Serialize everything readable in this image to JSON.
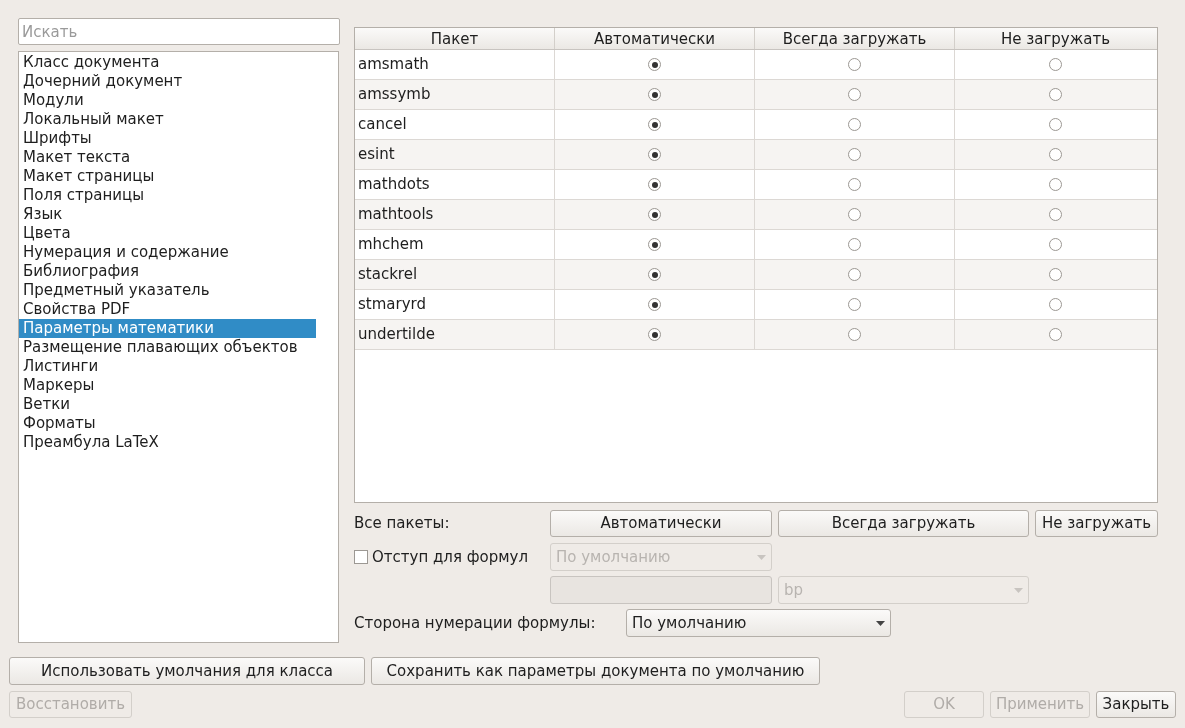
{
  "search": {
    "placeholder": "Искать"
  },
  "sidebar": {
    "items": [
      {
        "label": "Класс документа",
        "selected": false
      },
      {
        "label": "Дочерний документ",
        "selected": false
      },
      {
        "label": "Модули",
        "selected": false
      },
      {
        "label": "Локальный макет",
        "selected": false
      },
      {
        "label": "Шрифты",
        "selected": false
      },
      {
        "label": "Макет текста",
        "selected": false
      },
      {
        "label": "Макет страницы",
        "selected": false
      },
      {
        "label": "Поля страницы",
        "selected": false
      },
      {
        "label": "Язык",
        "selected": false
      },
      {
        "label": "Цвета",
        "selected": false
      },
      {
        "label": "Нумерация и содержание",
        "selected": false
      },
      {
        "label": "Библиография",
        "selected": false
      },
      {
        "label": "Предметный указатель",
        "selected": false
      },
      {
        "label": "Свойства PDF",
        "selected": false
      },
      {
        "label": "Параметры математики",
        "selected": true
      },
      {
        "label": "Размещение плавающих объектов",
        "selected": false
      },
      {
        "label": "Листинги",
        "selected": false
      },
      {
        "label": "Маркеры",
        "selected": false
      },
      {
        "label": "Ветки",
        "selected": false
      },
      {
        "label": "Форматы",
        "selected": false
      },
      {
        "label": "Преамбула LaTeX",
        "selected": false
      }
    ]
  },
  "table": {
    "columns": [
      "Пакет",
      "Автоматически",
      "Всегда загружать",
      "Не загружать"
    ],
    "rows": [
      {
        "name": "amsmath",
        "options": [
          {
            "selected": true
          },
          {
            "selected": false
          },
          {
            "selected": false
          }
        ]
      },
      {
        "name": "amssymb",
        "options": [
          {
            "selected": true
          },
          {
            "selected": false
          },
          {
            "selected": false
          }
        ]
      },
      {
        "name": "cancel",
        "options": [
          {
            "selected": true
          },
          {
            "selected": false
          },
          {
            "selected": false
          }
        ]
      },
      {
        "name": "esint",
        "options": [
          {
            "selected": true
          },
          {
            "selected": false
          },
          {
            "selected": false
          }
        ]
      },
      {
        "name": "mathdots",
        "options": [
          {
            "selected": true
          },
          {
            "selected": false
          },
          {
            "selected": false
          }
        ]
      },
      {
        "name": "mathtools",
        "options": [
          {
            "selected": true
          },
          {
            "selected": false
          },
          {
            "selected": false
          }
        ]
      },
      {
        "name": "mhchem",
        "options": [
          {
            "selected": true
          },
          {
            "selected": false
          },
          {
            "selected": false
          }
        ]
      },
      {
        "name": "stackrel",
        "options": [
          {
            "selected": true
          },
          {
            "selected": false
          },
          {
            "selected": false
          }
        ]
      },
      {
        "name": "stmaryrd",
        "options": [
          {
            "selected": true
          },
          {
            "selected": false
          },
          {
            "selected": false
          }
        ]
      },
      {
        "name": "undertilde",
        "options": [
          {
            "selected": true
          },
          {
            "selected": false
          },
          {
            "selected": false
          }
        ]
      }
    ]
  },
  "all_packages": {
    "label": "Все пакеты:",
    "buttons": [
      "Автоматически",
      "Всегда загружать",
      "Не загружать"
    ]
  },
  "indent": {
    "label": "Отступ для формул",
    "checked": false,
    "combo": {
      "value": "По умолчанию",
      "disabled": true
    },
    "length": {
      "disabled": true
    },
    "unit": {
      "value": "bp",
      "disabled": true
    }
  },
  "numbering_side": {
    "label": "Сторона нумерации формулы:",
    "value": "По умолчанию"
  },
  "class_buttons": [
    "Использовать умолчания для класса",
    "Сохранить как параметры документа по умолчанию"
  ],
  "footer": {
    "restore": {
      "label": "Восстановить",
      "disabled": true
    },
    "buttons": [
      {
        "label": "OK",
        "disabled": true
      },
      {
        "label": "Применить",
        "disabled": true
      },
      {
        "label": "Закрыть",
        "disabled": false
      }
    ]
  }
}
